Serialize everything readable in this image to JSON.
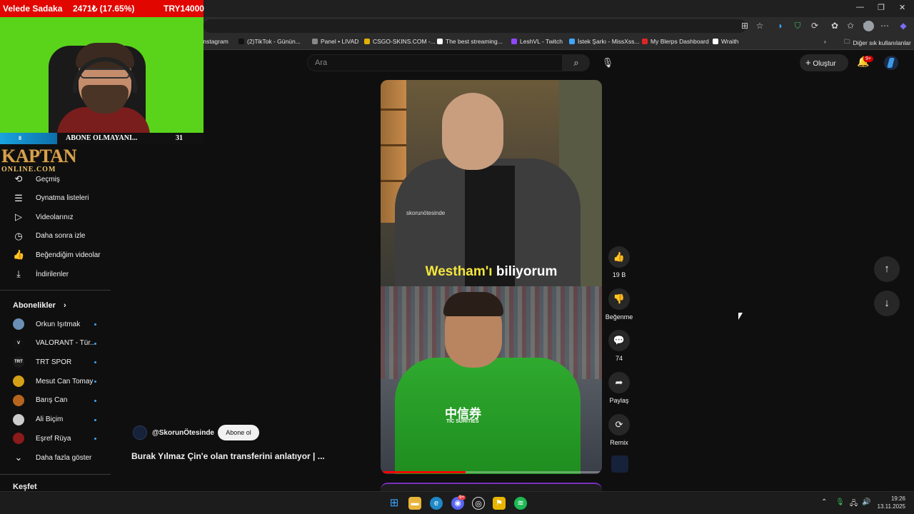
{
  "stream_overlay": {
    "donor": "Velede Sadaka",
    "stat": "2471₺ (17.65%)",
    "goal": "TRY14000",
    "sub_goal_count": "8",
    "sub_goal_label": "ABONE OLMAYANI...",
    "sub_goal_total": "31",
    "logo_main": "KAPTAN",
    "logo_sub": "ONLINE.COM"
  },
  "bookmarks": [
    {
      "label": "Instagram",
      "color": "#c13584"
    },
    {
      "label": "(2)TikTok - Günün...",
      "color": "#111111"
    },
    {
      "label": "Panel • LIVAD",
      "color": "#888888"
    },
    {
      "label": "CSGO-SKINS.COM -...",
      "color": "#e2b007"
    },
    {
      "label": "The best streaming...",
      "color": "#ffffff"
    },
    {
      "label": "LeshVL - Twitch",
      "color": "#9146ff"
    },
    {
      "label": "İstek Şarkı - MissXss...",
      "color": "#3ea6ff"
    },
    {
      "label": "My Blerps Dashboard",
      "color": "#e02424"
    },
    {
      "label": "Wraith",
      "color": "#ffffff"
    }
  ],
  "bookmarks_other": "Diğer sık kullanılanlar",
  "header": {
    "search_placeholder": "Ara",
    "create_label": "Oluştur",
    "notif_count": "9+"
  },
  "sidebar": {
    "you_items": [
      {
        "label": "Geçmiş",
        "icon": "history-icon",
        "glyph": "⟲"
      },
      {
        "label": "Oynatma listeleri",
        "icon": "playlist-icon",
        "glyph": "☰"
      },
      {
        "label": "Videolarınız",
        "icon": "your-videos-icon",
        "glyph": "▷"
      },
      {
        "label": "Daha sonra izle",
        "icon": "watch-later-icon",
        "glyph": "◷"
      },
      {
        "label": "Beğendiğim videolar",
        "icon": "like-icon",
        "glyph": "👍"
      },
      {
        "label": "İndirilenler",
        "icon": "download-icon",
        "glyph": "⤓"
      }
    ],
    "subs_title": "Abonelikler",
    "subscriptions": [
      {
        "label": "Orkun Işıtmak",
        "color": "#6b8fb5",
        "abbr": ""
      },
      {
        "label": "VALORANT - Tür...",
        "color": "#111111",
        "abbr": "V"
      },
      {
        "label": "TRT SPOR",
        "color": "#1a1a1a",
        "abbr": "TRT"
      },
      {
        "label": "Mesut Can Tomay",
        "color": "#d4a017",
        "abbr": ""
      },
      {
        "label": "Barış Can",
        "color": "#b5651d",
        "abbr": ""
      },
      {
        "label": "Ali Biçim",
        "color": "#cccccc",
        "abbr": ""
      },
      {
        "label": "Eşref Rüya",
        "color": "#8b1a1a",
        "abbr": ""
      }
    ],
    "show_more": "Daha fazla göster",
    "explore": "Keşfet"
  },
  "short": {
    "watermark": "skorunötesinde",
    "caption_highlight": "Westham'ı",
    "caption_rest": " biliyorum",
    "sponsor": "中信券",
    "sponsor_sub": "TIC SURITIES",
    "progress": 0.38,
    "channel": "@SkorunÖtesinde",
    "subscribe": "Abone ol",
    "title": "Burak Yılmaz Çin'e olan transferini anlatıyor | ..."
  },
  "actions": {
    "like_count": "19 B",
    "dislike_label": "Beğenme",
    "comment_count": "74",
    "share_label": "Paylaş",
    "remix_label": "Remix"
  },
  "taskbar": {
    "time": "19:26",
    "date": "13.11.2025",
    "discord_badge": "9+"
  }
}
